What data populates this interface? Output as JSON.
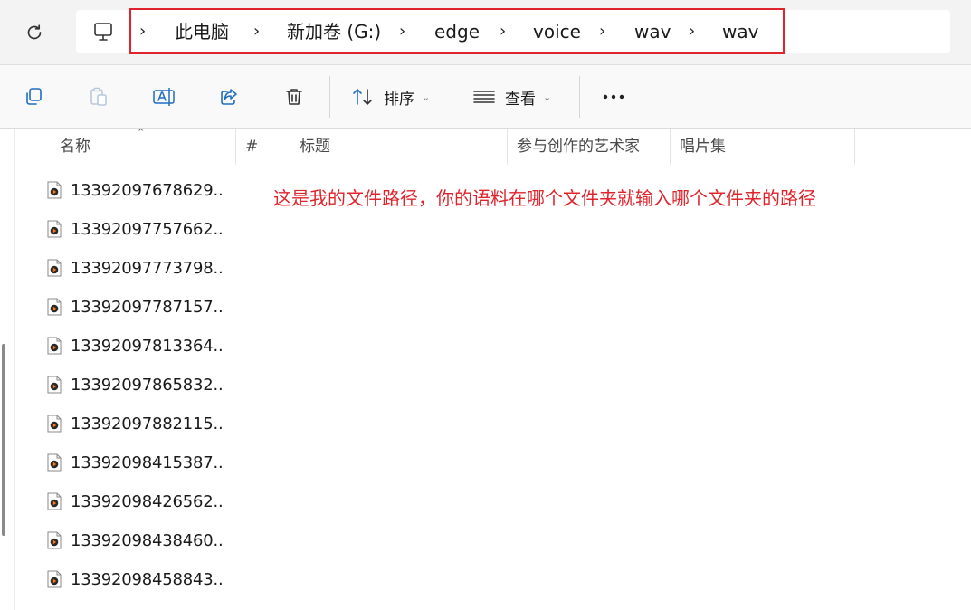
{
  "address_bar": {
    "breadcrumbs": [
      "此电脑",
      "新加卷 (G:)",
      "edge",
      "voice",
      "wav",
      "wav"
    ],
    "separator": "›"
  },
  "toolbar": {
    "sort_label": "排序",
    "view_label": "查看",
    "more_label": "···"
  },
  "columns": {
    "name": "名称",
    "number": "#",
    "title": "标题",
    "artist": "参与创作的艺术家",
    "album": "唱片集"
  },
  "files": [
    "13392097678629...",
    "13392097757662...",
    "13392097773798...",
    "13392097787157...",
    "13392097813364...",
    "13392097865832...",
    "13392097882115...",
    "13392098415387...",
    "13392098426562...",
    "13392098438460...",
    "13392098458843..."
  ],
  "annotation": "这是我的文件路径，你的语料在哪个文件夹就输入哪个文件夹的路径",
  "colors": {
    "annotation_red": "#e0242c",
    "accent_blue": "#1f6fbf"
  }
}
